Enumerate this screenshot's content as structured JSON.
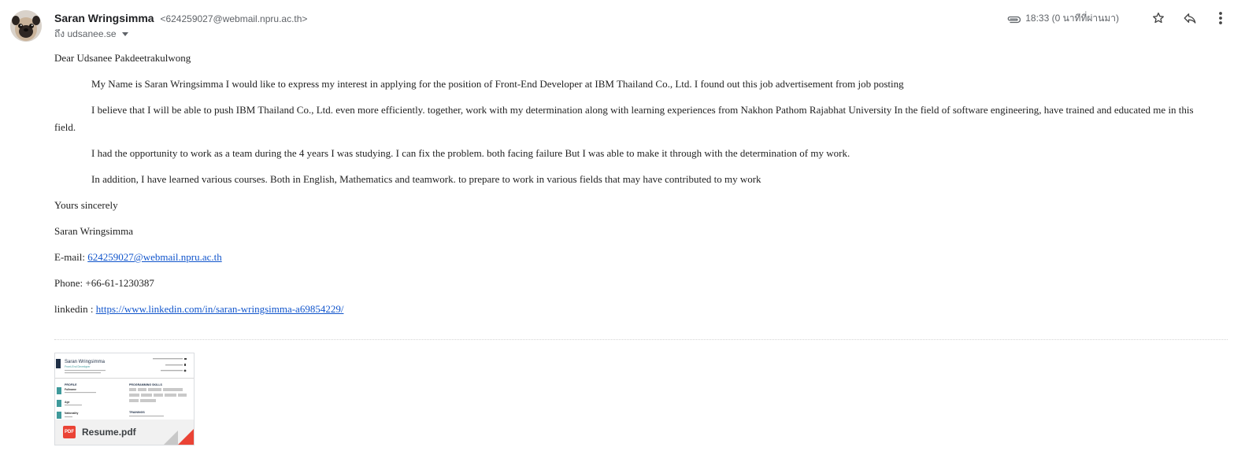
{
  "header": {
    "sender_name": "Saran Wringsimma",
    "sender_email": "<624259027@webmail.npru.ac.th>",
    "recipient": "ถึง udsanee.se",
    "time": "18:33 (0 นาทีที่ผ่านมา)",
    "icons": {
      "attachment": "paperclip-icon",
      "star": "star-icon",
      "reply": "reply-icon",
      "more": "more-vert-icon",
      "dropdown": "chevron-down-icon"
    }
  },
  "email": {
    "greeting": "Dear Udsanee Pakdeetrakulwong",
    "paragraphs": [
      "My Name is Saran Wringsimma I would like to express my interest in applying for the position of Front-End Developer at IBM Thailand Co., Ltd. I found out this job advertisement from job posting",
      "I believe that I will be able to push IBM Thailand Co., Ltd. even more efficiently. together, work with my determination along with learning experiences from Nakhon Pathom Rajabhat University In the field of software engineering, have trained and educated me in this field.",
      "I had the opportunity to work as a team during the 4 years I was studying. I can fix the problem. both facing failure But I was able to make it through with the determination of my work.",
      "In addition, I have learned various courses. Both in English, Mathematics and teamwork. to prepare to work in various fields that may have contributed to my work"
    ],
    "closing": "Yours sincerely",
    "signature_name": "Saran Wringsimma",
    "email_label": "E-mail: ",
    "email_link": "624259027@webmail.npru.ac.th",
    "phone": "Phone: +66-61-1230387",
    "linkedin_label": "linkedin : ",
    "linkedin_link": "https://www.linkedin.com/in/saran-wringsimma-a69854229/"
  },
  "attachment": {
    "file_name": "Resume.pdf",
    "type_badge": "PDF",
    "preview": {
      "name": "Saran Wringsimma",
      "role": "Front-End Developer",
      "profile_heading": "PROFILE",
      "skills_heading": "PROGRAMMING SKILLS",
      "trainings_heading": "TRAININGS",
      "fields": [
        "Fullname",
        "Age",
        "Nationality"
      ]
    }
  },
  "colors": {
    "link": "#1155cc",
    "pdf_red": "#ea4335",
    "teal": "#3f9a9b",
    "muted": "#5f6368"
  }
}
